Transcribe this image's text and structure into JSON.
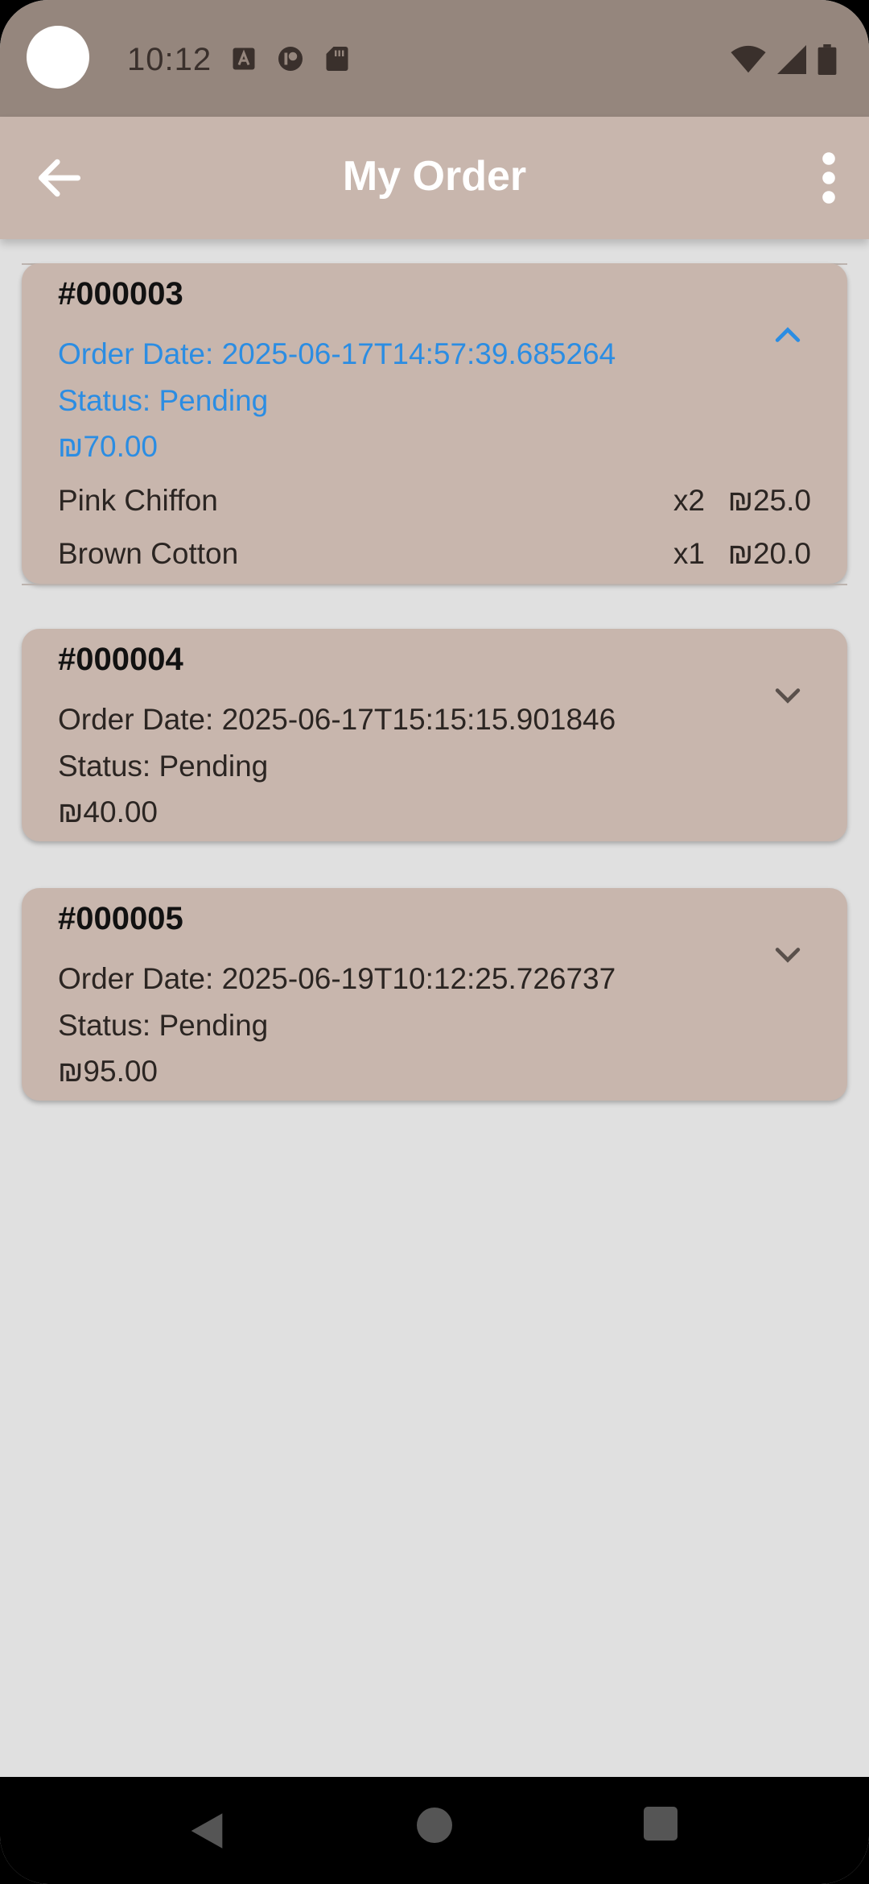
{
  "status_bar": {
    "time": "10:12",
    "left_icons": [
      "font-icon",
      "notification-app-icon",
      "sd-card-icon"
    ],
    "right_icons": [
      "wifi-icon",
      "signal-icon",
      "battery-icon"
    ]
  },
  "app_bar": {
    "title": "My Order",
    "back_icon": "arrow-left-icon",
    "more_icon": "more-vert-icon",
    "background": "#c8b6ad"
  },
  "orders": [
    {
      "id": "#000003",
      "order_date": "Order Date: 2025-06-17T14:57:39.685264",
      "status": "Status: Pending",
      "total": "₪70.00",
      "expanded": true,
      "items": [
        {
          "name": "Pink Chiffon",
          "qty": "x2",
          "price": "₪25.0"
        },
        {
          "name": "Brown Cotton",
          "qty": "x1",
          "price": "₪20.0"
        }
      ]
    },
    {
      "id": "#000004",
      "order_date": "Order Date: 2025-06-17T15:15:15.901846",
      "status": "Status: Pending",
      "total": "₪40.00",
      "expanded": false
    },
    {
      "id": "#000005",
      "order_date": "Order Date: 2025-06-19T10:12:25.726737",
      "status": "Status: Pending",
      "total": "₪95.00",
      "expanded": false
    }
  ],
  "colors": {
    "accent_blue": "#2b8de3",
    "card": "#c8b6ad",
    "page_background": "#e0e0e0",
    "status_bar": "#95867d"
  },
  "nav_bar": {
    "icons": [
      "nav-back-icon",
      "nav-home-icon",
      "nav-recents-icon"
    ]
  }
}
